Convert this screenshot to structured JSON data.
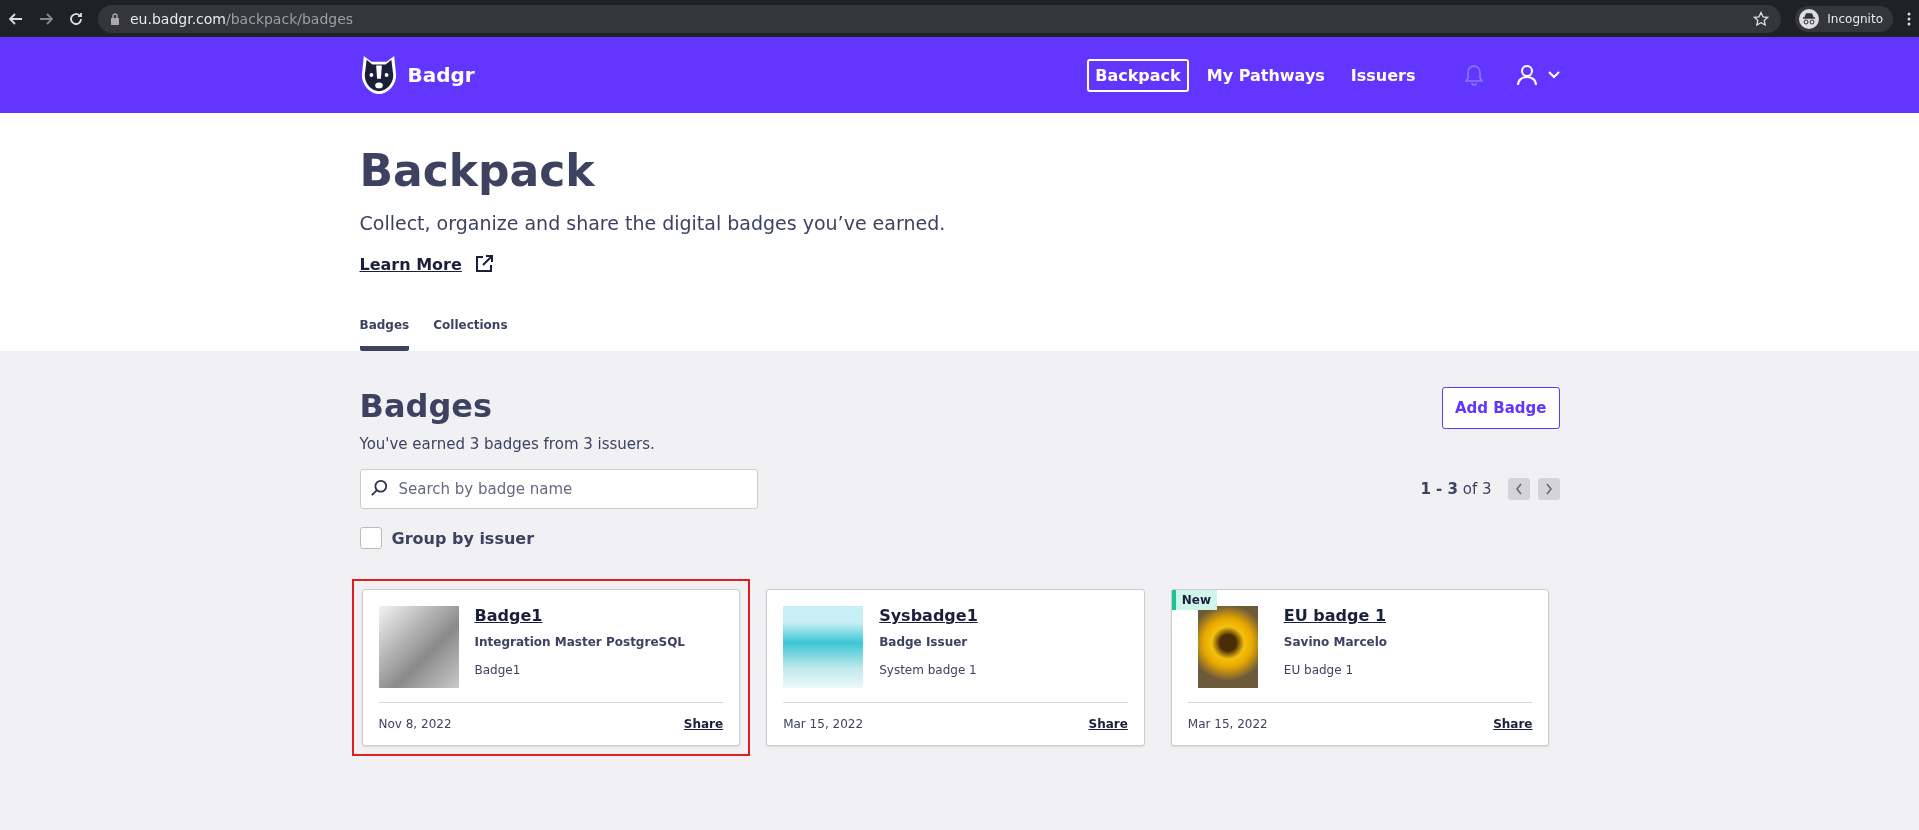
{
  "browser": {
    "url_host": "eu.badgr.com",
    "url_path": "/backpack/badges",
    "profile": "Incognito"
  },
  "nav": {
    "brand": "Badgr",
    "links": [
      {
        "label": "Backpack",
        "selected": true
      },
      {
        "label": "My Pathways",
        "selected": false
      },
      {
        "label": "Issuers",
        "selected": false
      }
    ]
  },
  "header": {
    "title": "Backpack",
    "subtitle": "Collect, organize and share the digital badges you’ve earned.",
    "learn_more": "Learn More"
  },
  "tabs": [
    {
      "label": "Badges",
      "selected": true
    },
    {
      "label": "Collections",
      "selected": false
    }
  ],
  "badges": {
    "title": "Badges",
    "summary": "You've earned 3 badges from 3 issuers.",
    "add_button": "Add Badge",
    "search": {
      "placeholder": "Search by badge name"
    },
    "group_by": {
      "label": "Group by issuer",
      "checked": false
    },
    "pagination": {
      "range": "1 - 3",
      "total": "of 3"
    },
    "cards": [
      {
        "name": "Badge1",
        "issuer": "Integration Master PostgreSQL",
        "description": "Badge1",
        "date": "Nov 8, 2022",
        "share": "Share",
        "highlighted": true,
        "is_new": false
      },
      {
        "name": "Sysbadge1",
        "issuer": "Badge Issuer",
        "description": "System badge 1",
        "date": "Mar 15, 2022",
        "share": "Share",
        "highlighted": false,
        "is_new": false
      },
      {
        "name": "EU badge 1",
        "issuer": "Savino Marcelo",
        "description": "EU badge 1",
        "date": "Mar 15, 2022",
        "share": "Share",
        "highlighted": false,
        "is_new": true,
        "new_label": "New"
      }
    ]
  }
}
